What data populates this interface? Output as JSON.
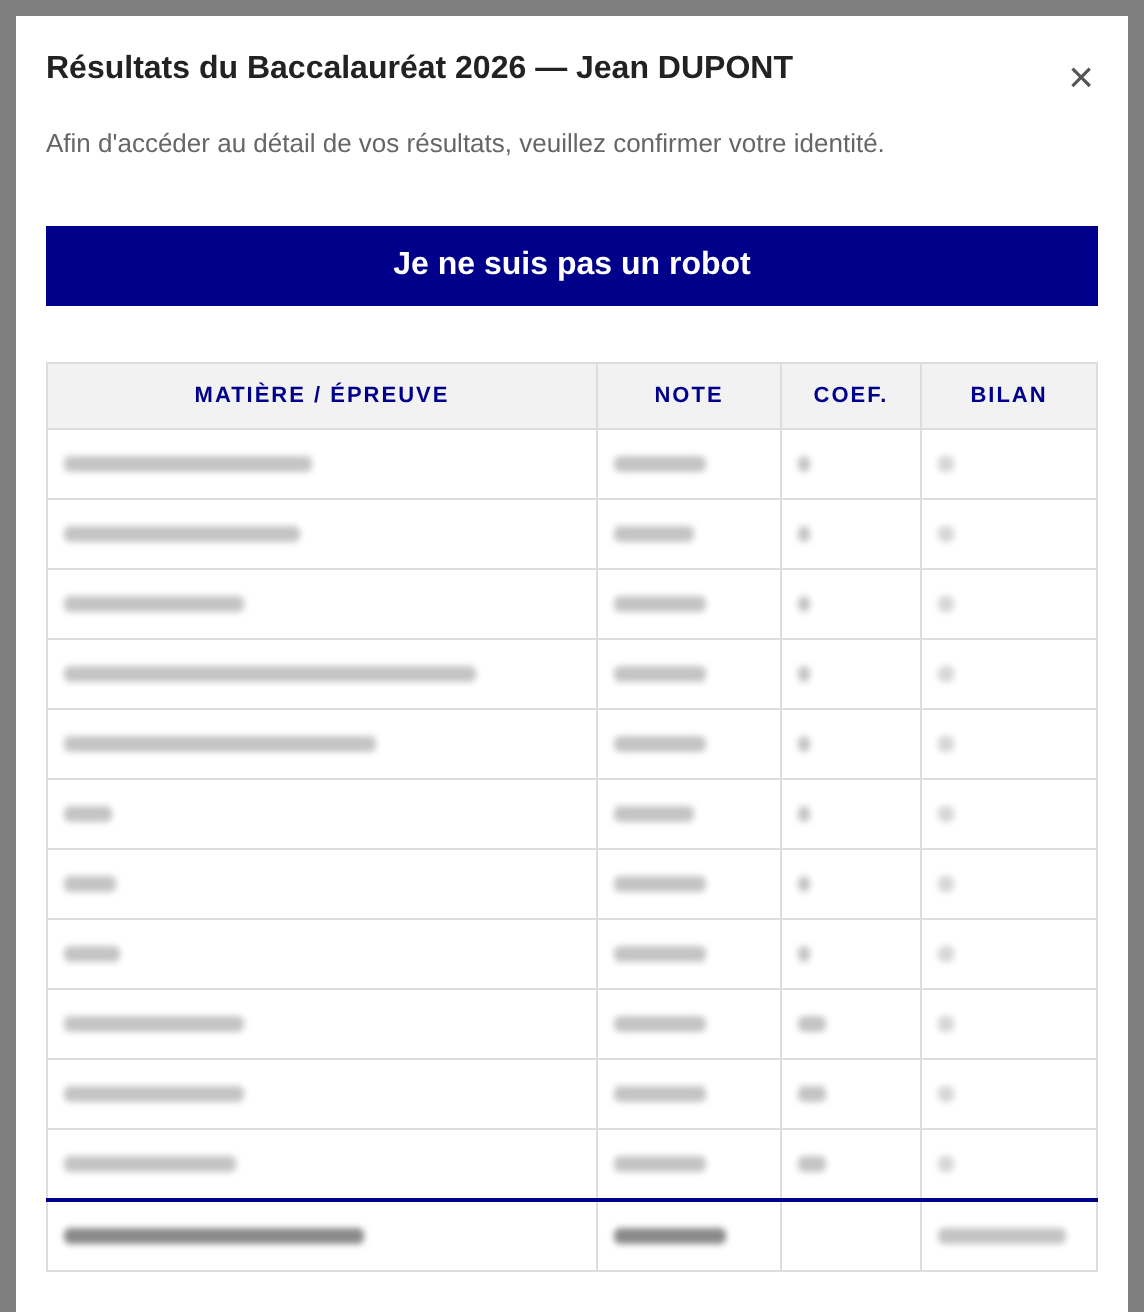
{
  "dialog": {
    "title": "Résultats du Baccalauréat 2026 — Jean DUPONT",
    "close": "×",
    "message": "Afin d'accéder au détail de vos résultats, veuillez confirmer votre identité.",
    "button": "Je ne suis pas un robot"
  },
  "table": {
    "columns": [
      "MATIÈRE / ÉPREUVE",
      "NOTE",
      "COEF.",
      "BILAN"
    ],
    "rows": [
      {
        "kind": "redacted"
      },
      {
        "kind": "redacted"
      },
      {
        "kind": "redacted"
      },
      {
        "kind": "redacted"
      },
      {
        "kind": "redacted"
      },
      {
        "kind": "redacted"
      },
      {
        "kind": "redacted"
      },
      {
        "kind": "redacted"
      },
      {
        "kind": "redacted"
      },
      {
        "kind": "redacted"
      },
      {
        "kind": "redacted"
      },
      {
        "kind": "redacted_total"
      }
    ]
  }
}
